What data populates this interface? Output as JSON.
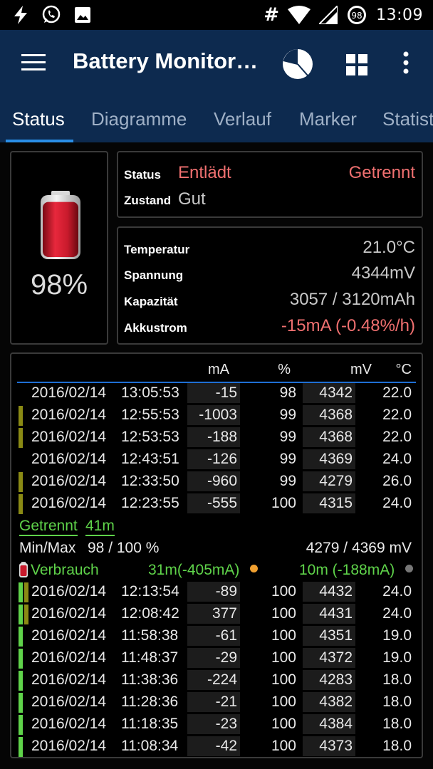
{
  "status_bar": {
    "time": "13:09",
    "hash": "#",
    "battery_level": "98",
    "left_icons": [
      "flash-icon",
      "whatsapp-icon",
      "image-icon"
    ],
    "right_icons": [
      "wifi-icon",
      "signal-icon",
      "battery-icon"
    ]
  },
  "app_bar": {
    "title": "Battery Monitor…",
    "icons": [
      "menu-icon",
      "pie-chart-icon",
      "grid-icon",
      "more-vert-icon"
    ]
  },
  "tabs": [
    {
      "label": "Status",
      "active": true
    },
    {
      "label": "Diagramme",
      "active": false
    },
    {
      "label": "Verlauf",
      "active": false
    },
    {
      "label": "Marker",
      "active": false
    },
    {
      "label": "Statist",
      "active": false
    }
  ],
  "battery": {
    "percent": "98%",
    "level_value": 98,
    "fill_color": "#d21e32"
  },
  "status_panel": {
    "status_label": "Status",
    "status_value": "Entlädt",
    "connection_value": "Getrennt",
    "zustand_label": "Zustand",
    "zustand_value": "Gut"
  },
  "metrics": [
    {
      "label": "Temperatur",
      "value": "21.0°C",
      "highlight": false
    },
    {
      "label": "Spannung",
      "value": "4344mV",
      "highlight": false
    },
    {
      "label": "Kapazität",
      "value": "3057 / 3120mAh",
      "highlight": false
    },
    {
      "label": "Akkustrom",
      "value": "-15mA (-0.48%/h)",
      "highlight": true
    }
  ],
  "table": {
    "headers": {
      "ma": "mA",
      "pct": "%",
      "mv": "mV",
      "temp": "°C"
    },
    "rows_top": [
      {
        "date": "2016/02/14",
        "time": "13:05:53",
        "ma": "-15",
        "pct": "98",
        "mv": "4342",
        "temp": "22.0",
        "bars": []
      },
      {
        "date": "2016/02/14",
        "time": "12:55:53",
        "ma": "-1003",
        "pct": "99",
        "mv": "4368",
        "temp": "22.0",
        "bars": [
          "olive"
        ]
      },
      {
        "date": "2016/02/14",
        "time": "12:53:53",
        "ma": "-188",
        "pct": "99",
        "mv": "4368",
        "temp": "22.0",
        "bars": [
          "olive"
        ]
      },
      {
        "date": "2016/02/14",
        "time": "12:43:51",
        "ma": "-126",
        "pct": "99",
        "mv": "4369",
        "temp": "24.0",
        "bars": []
      },
      {
        "date": "2016/02/14",
        "time": "12:33:50",
        "ma": "-960",
        "pct": "99",
        "mv": "4279",
        "temp": "26.0",
        "bars": [
          "olive"
        ]
      },
      {
        "date": "2016/02/14",
        "time": "12:23:55",
        "ma": "-555",
        "pct": "100",
        "mv": "4315",
        "temp": "24.0",
        "bars": [
          "olive"
        ]
      }
    ],
    "separator": {
      "status": "Getrennt",
      "duration": "41m"
    },
    "minmax": {
      "label": "Min/Max",
      "pct_range": "98 / 100 %",
      "mv_range": "4279 / 4369 mV"
    },
    "verbrauch": {
      "label": "Verbrauch",
      "value_a": "31m(-405mA)",
      "value_b": "10m (-188mA)",
      "dot_a_color": "#f0a030",
      "dot_b_color": "#777777"
    },
    "rows_bottom": [
      {
        "date": "2016/02/14",
        "time": "12:13:54",
        "ma": "-89",
        "pct": "100",
        "mv": "4432",
        "temp": "24.0",
        "bars": [
          "green",
          "olive"
        ]
      },
      {
        "date": "2016/02/14",
        "time": "12:08:42",
        "ma": "377",
        "pct": "100",
        "mv": "4431",
        "temp": "24.0",
        "bars": [
          "green",
          "olive"
        ]
      },
      {
        "date": "2016/02/14",
        "time": "11:58:38",
        "ma": "-61",
        "pct": "100",
        "mv": "4351",
        "temp": "19.0",
        "bars": [
          "green"
        ]
      },
      {
        "date": "2016/02/14",
        "time": "11:48:37",
        "ma": "-29",
        "pct": "100",
        "mv": "4372",
        "temp": "19.0",
        "bars": [
          "green"
        ]
      },
      {
        "date": "2016/02/14",
        "time": "11:38:36",
        "ma": "-224",
        "pct": "100",
        "mv": "4283",
        "temp": "18.0",
        "bars": [
          "green"
        ]
      },
      {
        "date": "2016/02/14",
        "time": "11:28:36",
        "ma": "-21",
        "pct": "100",
        "mv": "4382",
        "temp": "18.0",
        "bars": [
          "green"
        ]
      },
      {
        "date": "2016/02/14",
        "time": "11:18:35",
        "ma": "-23",
        "pct": "100",
        "mv": "4384",
        "temp": "18.0",
        "bars": [
          "green"
        ]
      },
      {
        "date": "2016/02/14",
        "time": "11:08:34",
        "ma": "-42",
        "pct": "100",
        "mv": "4373",
        "temp": "18.0",
        "bars": [
          "green"
        ]
      }
    ]
  },
  "colors": {
    "app_bar": "#0d2a4f",
    "accent": "#2a8ee6",
    "discharge_red": "#f07070",
    "green": "#5fd34a",
    "olive": "#8a8a14"
  }
}
